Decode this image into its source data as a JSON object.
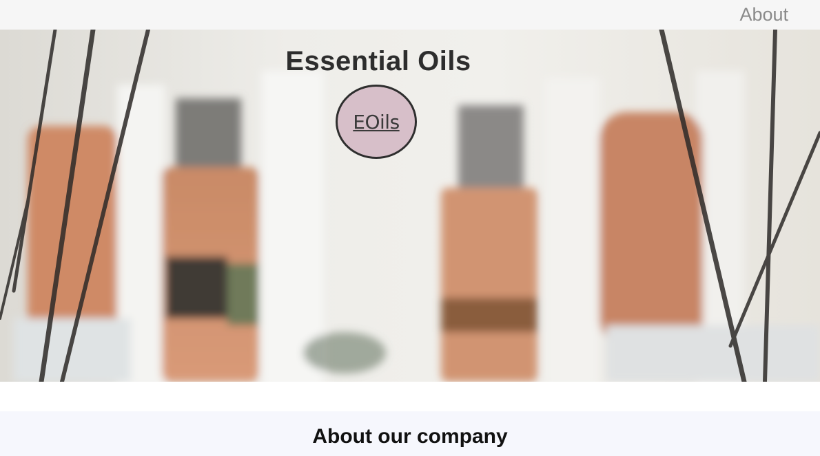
{
  "nav": {
    "about_label": "About"
  },
  "hero": {
    "title": "Essential Oils",
    "logo_text": "EOils",
    "background": "blurred photo of essential oil bottles with reed diffuser sticks"
  },
  "about": {
    "heading": "About our company"
  },
  "colors": {
    "topbar": "#f6f6f6",
    "nav_text": "#8a8a8a",
    "badge_fill": "#d7bfc9",
    "badge_border": "#2e2e2e",
    "section_bg": "#f6f7fd"
  }
}
